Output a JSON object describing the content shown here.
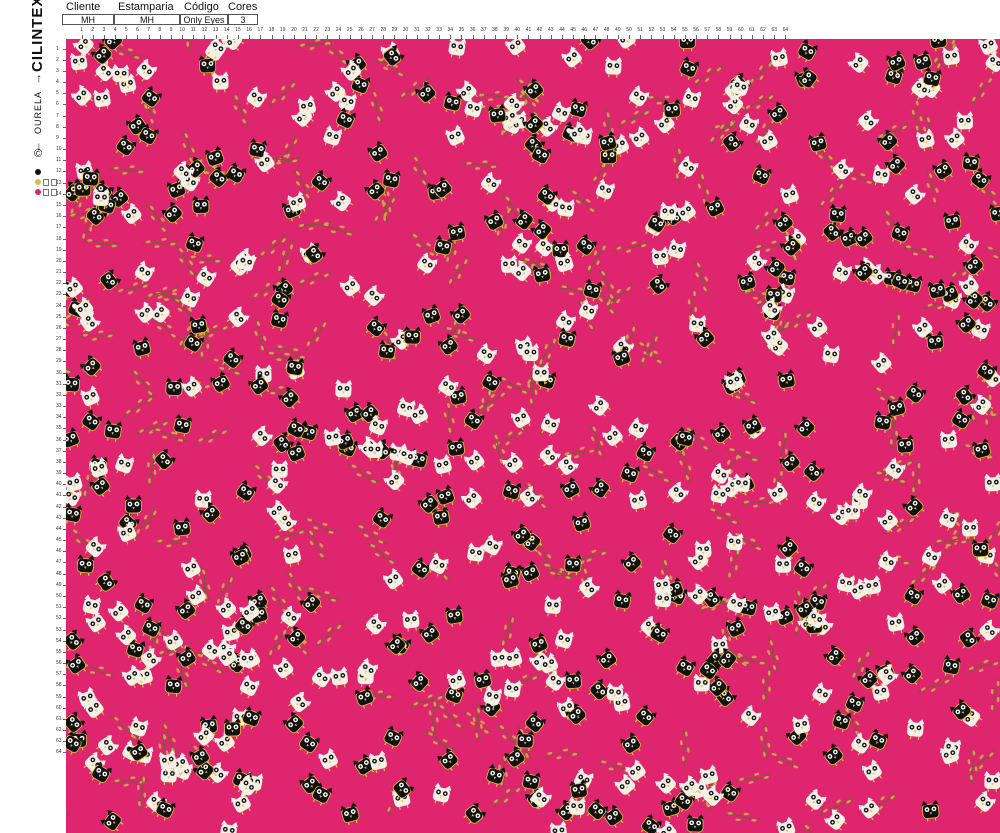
{
  "brand": {
    "name": "CILINTEX",
    "edge_label": "OURELA",
    "copyright": "©"
  },
  "colors": {
    "background": "#e0256f",
    "owl_dark": "#111111",
    "owl_light": "#f4f0e8",
    "branch": "#7a5a3a",
    "leaf": "#c9a24a",
    "accent": "#e8c23a"
  },
  "info_table": {
    "headers": [
      "Cliente",
      "Estamparia",
      "Código",
      "Cores"
    ],
    "values": [
      "MH",
      "MH",
      "Only Eyes",
      "3"
    ]
  },
  "swatches": [
    {
      "dot": "#111111"
    },
    {
      "dot": "#d4c14a"
    },
    {
      "dot": "#e0256f"
    }
  ],
  "ruler": {
    "top_max": 64,
    "left_max": 64
  },
  "pattern": {
    "motif": "owl-icon",
    "description_visible": false
  }
}
